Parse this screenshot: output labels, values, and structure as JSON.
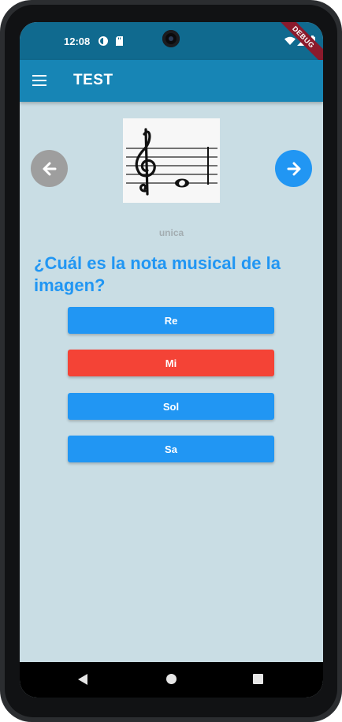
{
  "status_bar": {
    "time": "12:08",
    "debug_label": "DEBUG"
  },
  "app_bar": {
    "title": "TEST"
  },
  "content": {
    "caption": "unica",
    "question": "¿Cuál es la nota musical de la imagen?",
    "answers": [
      {
        "label": "Re",
        "color": "#2196f3"
      },
      {
        "label": "Mi",
        "color": "#f44336"
      },
      {
        "label": "Sol",
        "color": "#2196f3"
      },
      {
        "label": "Sa",
        "color": "#2196f3"
      }
    ]
  },
  "colors": {
    "status_bar": "#106a8f",
    "app_bar": "#1785b5",
    "background": "#c9dde4",
    "accent": "#2196f3",
    "wrong": "#f44336",
    "disabled": "#9e9e9e"
  },
  "icons": {
    "menu": "hamburger-menu-icon",
    "prev": "arrow-left-icon",
    "next": "arrow-right-icon"
  }
}
